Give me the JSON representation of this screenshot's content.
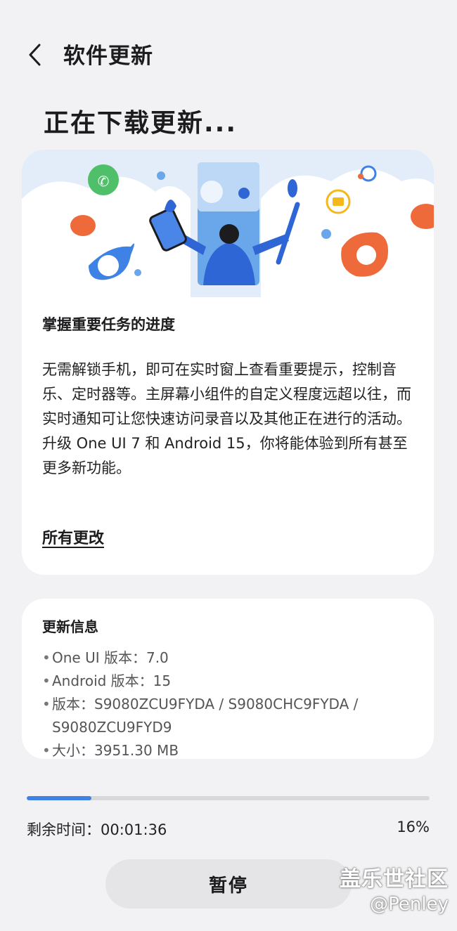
{
  "header": {
    "title": "软件更新",
    "back_icon": "chevron-left-icon"
  },
  "page_title": "正在下载更新...",
  "feature": {
    "title": "掌握重要任务的进度",
    "description": "无需解锁手机，即可在实时窗上查看重要提示，控制音乐、定时器等。主屏幕小组件的自定义程度远超以往，而实时通知可让您快速访问录音以及其他正在进行的活动。升级 One UI 7 和 Android 15，你将能体验到所有甚至更多新功能。",
    "all_changes_link": "所有更改"
  },
  "update_info": {
    "title": "更新信息",
    "items": [
      "One UI 版本：7.0",
      "Android 版本：15",
      "版本：S9080ZCU9FYDA / S9080CHC9FYDA / S9080ZCU9FYD9",
      "大小：3951.30 MB"
    ]
  },
  "download": {
    "progress_fraction": 0.16,
    "remaining_label": "剩余时间：00:01:36",
    "percent_label": "16%"
  },
  "buttons": {
    "pause": "暂停"
  },
  "watermark": {
    "title": "盖乐世社区",
    "author": "@Penley"
  },
  "colors": {
    "accent": "#3e82e5",
    "background": "#f2f2f4",
    "card": "#ffffff"
  }
}
